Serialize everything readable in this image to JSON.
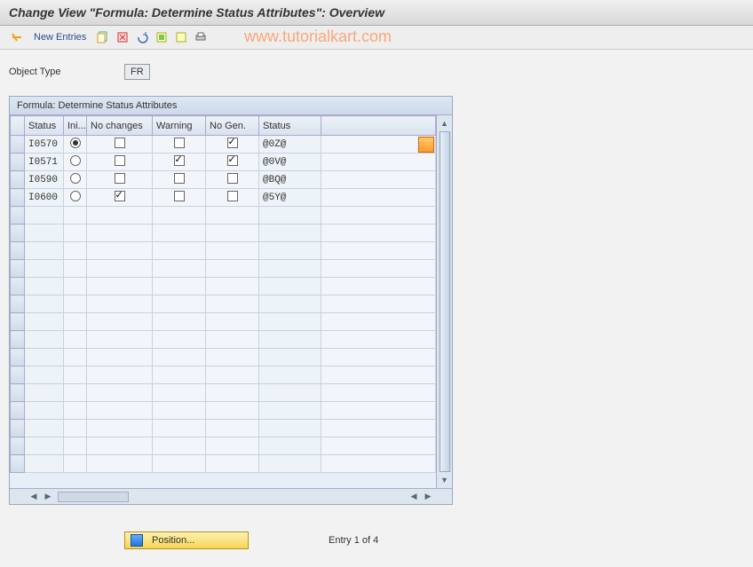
{
  "title": "Change View \"Formula: Determine Status Attributes\": Overview",
  "watermark": "www.tutorialkart.com",
  "toolbar": {
    "new_entries": "New Entries"
  },
  "object_type": {
    "label": "Object Type",
    "value": "FR"
  },
  "table": {
    "title": "Formula: Determine Status Attributes",
    "cols": {
      "status": "Status",
      "ini": "Ini...",
      "nochg": "No changes",
      "warn": "Warning",
      "nogen": "No Gen.",
      "status2": "Status"
    },
    "rows": [
      {
        "status": "I0570",
        "ini": true,
        "nochg": false,
        "warn": false,
        "nogen": true,
        "status2": "@0Z@"
      },
      {
        "status": "I0571",
        "ini": false,
        "nochg": false,
        "warn": true,
        "nogen": true,
        "status2": "@0V@"
      },
      {
        "status": "I0590",
        "ini": false,
        "nochg": false,
        "warn": false,
        "nogen": false,
        "status2": "@BQ@"
      },
      {
        "status": "I0600",
        "ini": false,
        "nochg": true,
        "warn": false,
        "nogen": false,
        "status2": "@5Y@"
      }
    ]
  },
  "footer": {
    "position": "Position...",
    "entry": "Entry 1 of 4"
  }
}
